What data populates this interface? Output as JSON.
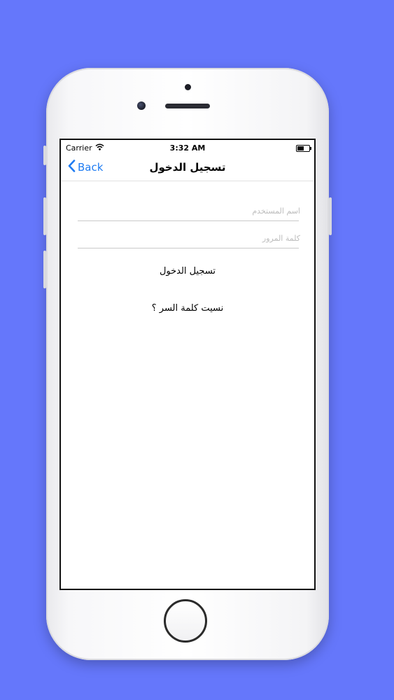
{
  "status_bar": {
    "carrier": "Carrier",
    "time": "3:32 AM"
  },
  "nav": {
    "back_label": "Back",
    "title": "تسجيل الدخول"
  },
  "form": {
    "username_placeholder": "اسم المستخدم",
    "password_placeholder": "كلمة المرور",
    "login_label": "تسجيل الدخول",
    "forgot_label": "نسيت كلمة السر ؟"
  },
  "colors": {
    "background": "#6577fb",
    "accent": "#1f7cf2"
  }
}
